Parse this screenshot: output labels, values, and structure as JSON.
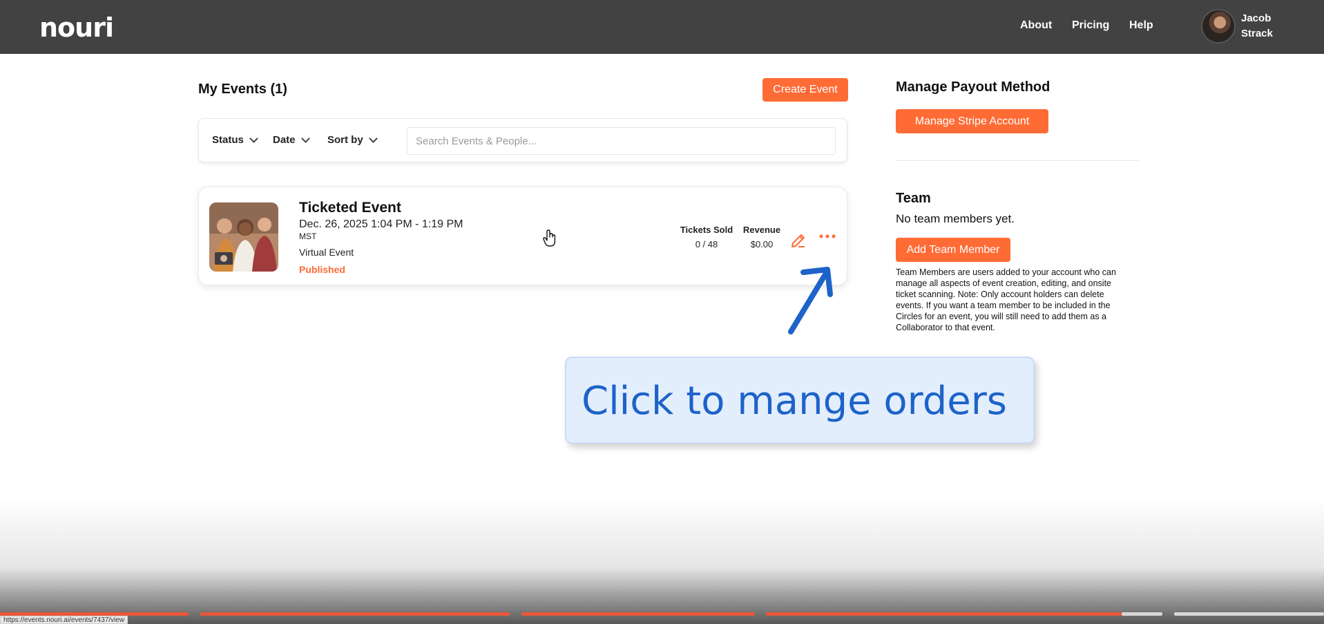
{
  "header": {
    "logo": "nouri",
    "nav": [
      "About",
      "Pricing",
      "Help"
    ],
    "user": {
      "first_name": "Jacob",
      "last_name": "Strack"
    }
  },
  "events": {
    "title": "My Events (1)",
    "create_button": "Create Event",
    "filters": [
      "Status",
      "Date",
      "Sort by"
    ],
    "search_placeholder": "Search Events & People...",
    "items": [
      {
        "title": "Ticketed Event",
        "date": "Dec. 26, 2025 1:04 PM - 1:19 PM",
        "timezone": "MST",
        "type": "Virtual Event",
        "status": "Published",
        "tickets_label": "Tickets Sold",
        "tickets_value": "0 / 48",
        "revenue_label": "Revenue",
        "revenue_value": "$0.00"
      }
    ]
  },
  "payout": {
    "title": "Manage Payout Method",
    "button": "Manage Stripe Account"
  },
  "team": {
    "title": "Team",
    "empty_text": "No team members yet.",
    "add_button": "Add Team Member",
    "description": "Team Members are users added to your account who can manage all aspects of event creation, editing, and onsite ticket scanning. Note: Only account holders can delete events. If you want a team member to be included in the Circles for an event, you will still need to add them as a Collaborator to that event."
  },
  "callout": {
    "text": "Click to mange orders"
  },
  "status_bar": {
    "url": "https://events.nouri.ai/events/7437/view"
  },
  "colors": {
    "accent": "#ff6b35",
    "topbar": "#424242",
    "callout_text": "#1d63c9",
    "callout_bg": "#e3eefc"
  }
}
